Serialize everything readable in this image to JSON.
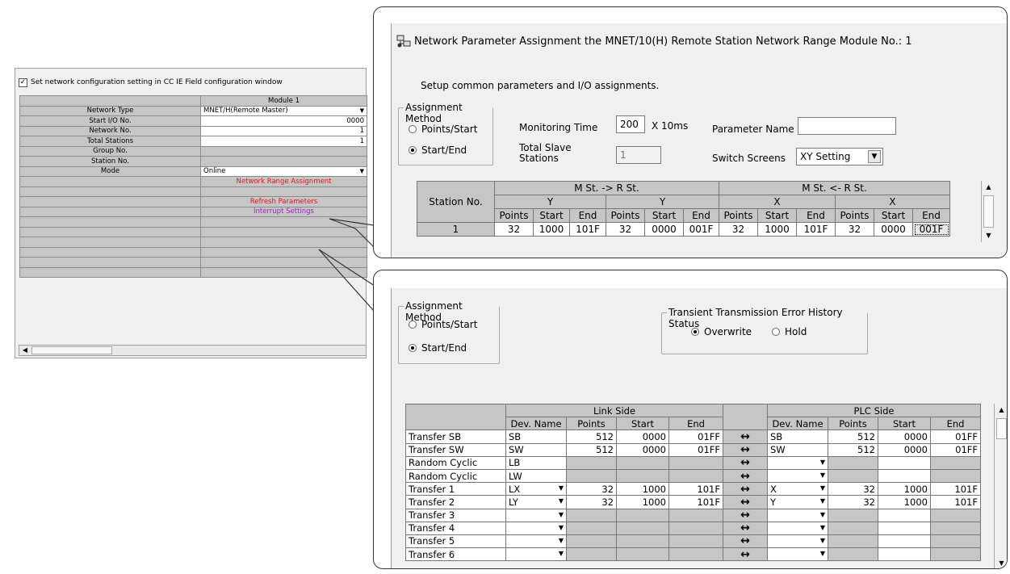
{
  "left_panel": {
    "checkbox_label": "Set network configuration setting in CC IE Field configuration window",
    "column_header": "Module 1",
    "rows": {
      "network_type": {
        "label": "Network Type",
        "value": "MNET/H(Remote Master)"
      },
      "start_io": {
        "label": "Start I/O No.",
        "value": "0000"
      },
      "network_no": {
        "label": "Network No.",
        "value": "1"
      },
      "total_stations": {
        "label": "Total Stations",
        "value": "1"
      },
      "group_no": {
        "label": "Group No."
      },
      "station_no": {
        "label": "Station No."
      },
      "mode": {
        "label": "Mode",
        "value": "Online"
      }
    },
    "links": {
      "network_range": "Network Range Assignment",
      "refresh": "Refresh Parameters",
      "interrupt": "Interrupt Settings"
    },
    "colors": {
      "link_red": "#e8161b",
      "link_purple": "#a01fc4"
    }
  },
  "top_window": {
    "title": "Network Parameter  Assignment the MNET/10(H) Remote Station Network Range Module No.: 1",
    "subtitle": "Setup common parameters and I/O assignments.",
    "assignment_method": {
      "label": "Assignment Method",
      "opt1": "Points/Start",
      "opt2": "Start/End",
      "selected": "Start/End"
    },
    "monitoring_time": {
      "label": "Monitoring Time",
      "value": "200",
      "unit": "X 10ms"
    },
    "total_slave": {
      "label1": "Total Slave",
      "label2": "Stations",
      "value": "1"
    },
    "parameter_name": {
      "label": "Parameter Name",
      "value": ""
    },
    "switch_screens": {
      "label": "Switch Screens",
      "value": "XY Setting"
    },
    "grid": {
      "station_col": "Station No.",
      "group_out": "M St. -> R St.",
      "group_in": "M St. <- R St.",
      "y": "Y",
      "x": "X",
      "points": "Points",
      "start": "Start",
      "end": "End",
      "row": {
        "station": "1",
        "c1": "32",
        "c2": "1000",
        "c3": "101F",
        "c4": "32",
        "c5": "0000",
        "c6": "001F",
        "c7": "32",
        "c8": "1000",
        "c9": "101F",
        "c10": "32",
        "c11": "0000",
        "c12": "001F"
      }
    }
  },
  "bottom_window": {
    "assignment_method": {
      "label": "Assignment Method",
      "opt1": "Points/Start",
      "opt2": "Start/End",
      "selected": "Start/End"
    },
    "transient": {
      "label": "Transient Transmission Error History Status",
      "opt1": "Overwrite",
      "opt2": "Hold",
      "selected": "Overwrite"
    },
    "grid": {
      "link_side": "Link Side",
      "plc_side": "PLC Side",
      "dev_name": "Dev. Name",
      "points": "Points",
      "start": "Start",
      "end": "End",
      "arrow": "↔",
      "rows": [
        {
          "label": "Transfer SB",
          "ldev": "SB",
          "lpts": "512",
          "lstart": "0000",
          "lend": "01FF",
          "pdev": "SB",
          "ppts": "512",
          "pstart": "0000",
          "pend": "01FF"
        },
        {
          "label": "Transfer SW",
          "ldev": "SW",
          "lpts": "512",
          "lstart": "0000",
          "lend": "01FF",
          "pdev": "SW",
          "ppts": "512",
          "pstart": "0000",
          "pend": "01FF"
        },
        {
          "label": "Random Cyclic",
          "ldev": "LB",
          "lpts": "",
          "lstart": "",
          "lend": "",
          "pdev": "",
          "ppts": "",
          "pstart": "",
          "pend": ""
        },
        {
          "label": "Random Cyclic",
          "ldev": "LW",
          "lpts": "",
          "lstart": "",
          "lend": "",
          "pdev": "",
          "ppts": "",
          "pstart": "",
          "pend": ""
        },
        {
          "label": "Transfer 1",
          "ldev": "LX",
          "lpts": "32",
          "lstart": "1000",
          "lend": "101F",
          "pdev": "X",
          "ppts": "32",
          "pstart": "1000",
          "pend": "101F"
        },
        {
          "label": "Transfer 2",
          "ldev": "LY",
          "lpts": "32",
          "lstart": "1000",
          "lend": "101F",
          "pdev": "Y",
          "ppts": "32",
          "pstart": "1000",
          "pend": "101F"
        },
        {
          "label": "Transfer 3",
          "ldev": "",
          "lpts": "",
          "lstart": "",
          "lend": "",
          "pdev": "",
          "ppts": "",
          "pstart": "",
          "pend": ""
        },
        {
          "label": "Transfer 4",
          "ldev": "",
          "lpts": "",
          "lstart": "",
          "lend": "",
          "pdev": "",
          "ppts": "",
          "pstart": "",
          "pend": ""
        },
        {
          "label": "Transfer 5",
          "ldev": "",
          "lpts": "",
          "lstart": "",
          "lend": "",
          "pdev": "",
          "ppts": "",
          "pstart": "",
          "pend": ""
        },
        {
          "label": "Transfer 6",
          "ldev": "",
          "lpts": "",
          "lstart": "",
          "lend": "",
          "pdev": "",
          "ppts": "",
          "pstart": "",
          "pend": ""
        }
      ]
    }
  }
}
